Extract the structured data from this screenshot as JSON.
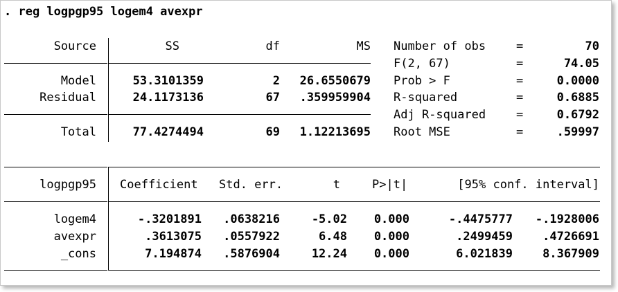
{
  "command": ". reg logpgp95 logem4 avexpr",
  "anova": {
    "headers": {
      "source": "Source",
      "ss": "SS",
      "df": "df",
      "ms": "MS"
    },
    "rows": [
      {
        "source": "Model",
        "ss": "53.3101359",
        "df": "2",
        "ms": "26.6550679"
      },
      {
        "source": "Residual",
        "ss": "24.1173136",
        "df": "67",
        "ms": ".359959904"
      }
    ],
    "total": {
      "source": "Total",
      "ss": "77.4274494",
      "df": "69",
      "ms": "1.12213695"
    }
  },
  "stats": [
    {
      "label": "Number of obs",
      "eq": "=",
      "value": "70"
    },
    {
      "label": "F(2, 67)",
      "eq": "=",
      "value": "74.05"
    },
    {
      "label": "Prob > F",
      "eq": "=",
      "value": "0.0000"
    },
    {
      "label": "R-squared",
      "eq": "=",
      "value": "0.6885"
    },
    {
      "label": "Adj R-squared",
      "eq": "=",
      "value": "0.6792"
    },
    {
      "label": "Root MSE",
      "eq": "=",
      "value": ".59997"
    }
  ],
  "coef": {
    "headers": {
      "dep": "logpgp95",
      "coef": "Coefficient",
      "se": "Std. err.",
      "t": "t",
      "p": "P>|t|",
      "ci": "[95% conf. interval]"
    },
    "rows": [
      {
        "var": "logem4",
        "coef": "-.3201891",
        "se": ".0638216",
        "t": "-5.02",
        "p": "0.000",
        "lo": "-.4475777",
        "hi": "-.1928006"
      },
      {
        "var": "avexpr",
        "coef": ".3613075",
        "se": ".0557922",
        "t": "6.48",
        "p": "0.000",
        "lo": ".2499459",
        "hi": ".4726691"
      },
      {
        "var": "_cons",
        "coef": "7.194874",
        "se": ".5876904",
        "t": "12.24",
        "p": "0.000",
        "lo": "6.021839",
        "hi": "8.367909"
      }
    ]
  }
}
